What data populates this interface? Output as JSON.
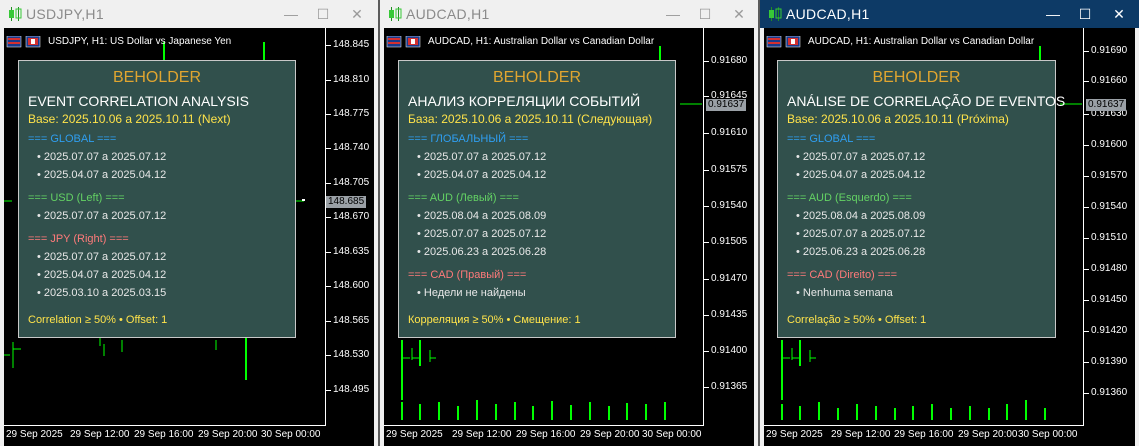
{
  "colors": {
    "candle": "#00ff00",
    "brand": "#e0a530",
    "yellow": "#ffe34a",
    "global": "#2f9ef0",
    "left_currency": "#64d264",
    "right_currency": "#ff7a7a",
    "panel_bg": "#31504c",
    "active_titlebar": "#0d3a66"
  },
  "windows": [
    {
      "title": "USDJPY,H1",
      "active": false,
      "symbol_line": "USDJPY, H1:  US Dollar vs Japanese Yen",
      "price_ticks": [
        "148.845",
        "148.810",
        "148.775",
        "148.740",
        "148.705",
        "148.670",
        "148.635",
        "148.600",
        "148.565",
        "148.530",
        "148.495"
      ],
      "current_price": "148.685",
      "time_labels": [
        "29 Sep 2025",
        "29 Sep 12:00",
        "29 Sep 16:00",
        "29 Sep 20:00",
        "30 Sep 00:00"
      ],
      "panel": {
        "brand": "BEHOLDER",
        "heading": "EVENT CORRELATION ANALYSIS",
        "base": "Base: 2025.10.06 a 2025.10.11 (Next)",
        "sections": [
          {
            "title": "=== GLOBAL ===",
            "kind": "global",
            "items": [
              "• 2025.07.07 a 2025.07.12",
              "• 2025.04.07 a 2025.04.12"
            ]
          },
          {
            "title": "=== USD (Left) ===",
            "kind": "left",
            "items": [
              "• 2025.07.07 a 2025.07.12"
            ]
          },
          {
            "title": "=== JPY (Right) ===",
            "kind": "right",
            "items": [
              "• 2025.07.07 a 2025.07.12",
              "• 2025.04.07 a 2025.04.12",
              "• 2025.03.10 a 2025.03.15"
            ]
          }
        ],
        "footer": "Correlation ≥ 50% • Offset: 1"
      }
    },
    {
      "title": "AUDCAD,H1",
      "active": false,
      "symbol_line": "AUDCAD, H1:  Australian Dollar vs Canadian Dollar",
      "price_ticks": [
        "0.91680",
        "0.91645",
        "0.91610",
        "0.91575",
        "0.91540",
        "0.91505",
        "0.91470",
        "0.91435",
        "0.91400",
        "0.91365"
      ],
      "current_price": "0.91637",
      "time_labels": [
        "29 Sep 2025",
        "29 Sep 12:00",
        "29 Sep 16:00",
        "29 Sep 20:00",
        "30 Sep 00:00"
      ],
      "panel": {
        "brand": "BEHOLDER",
        "heading": "АНАЛИЗ КОРРЕЛЯЦИИ СОБЫТИЙ",
        "base": "База: 2025.10.06 a 2025.10.11 (Следующая)",
        "sections": [
          {
            "title": "=== ГЛОБАЛЬНЫЙ ===",
            "kind": "global",
            "items": [
              "• 2025.07.07 a 2025.07.12",
              "• 2025.04.07 a 2025.04.12"
            ]
          },
          {
            "title": "=== AUD (Левый) ===",
            "kind": "left",
            "items": [
              "• 2025.08.04 a 2025.08.09",
              "• 2025.07.07 a 2025.07.12",
              "• 2025.06.23 a 2025.06.28"
            ]
          },
          {
            "title": "=== CAD (Правый) ===",
            "kind": "right",
            "items": [
              "• Недели не найдены"
            ]
          }
        ],
        "footer": "Корреляция ≥ 50% • Смещение: 1"
      }
    },
    {
      "title": "AUDCAD,H1",
      "active": true,
      "symbol_line": "AUDCAD, H1:  Australian Dollar vs Canadian Dollar",
      "price_ticks": [
        "0.91690",
        "0.91660",
        "0.91630",
        "0.91600",
        "0.91570",
        "0.91540",
        "0.91510",
        "0.91480",
        "0.91450",
        "0.91420",
        "0.91390",
        "0.91360"
      ],
      "current_price": "0.91637",
      "time_labels": [
        "29 Sep 2025",
        "29 Sep 12:00",
        "29 Sep 16:00",
        "29 Sep 20:00",
        "30 Sep 00:00"
      ],
      "panel": {
        "brand": "BEHOLDER",
        "heading": "ANÁLISE DE CORRELAÇÃO DE EVENTOS",
        "base": "Base: 2025.10.06 a 2025.10.11 (Próxima)",
        "sections": [
          {
            "title": "=== GLOBAL ===",
            "kind": "global",
            "items": [
              "• 2025.07.07 a 2025.07.12",
              "• 2025.04.07 a 2025.04.12"
            ]
          },
          {
            "title": "=== AUD (Esquerdo) ===",
            "kind": "left",
            "items": [
              "• 2025.08.04 a 2025.08.09",
              "• 2025.07.07 a 2025.07.12",
              "• 2025.06.23 a 2025.06.28"
            ]
          },
          {
            "title": "=== CAD (Direito) ===",
            "kind": "right",
            "items": [
              "• Nenhuma semana"
            ]
          }
        ],
        "footer": "Correlação ≥ 50% • Offset: 1"
      }
    }
  ]
}
